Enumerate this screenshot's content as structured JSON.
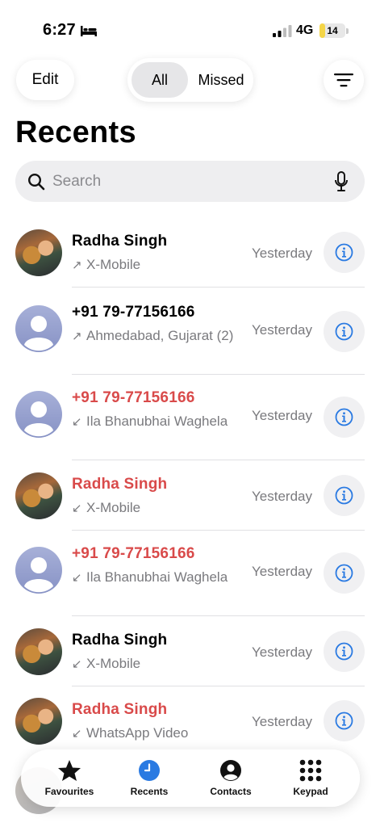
{
  "status_bar": {
    "time": "6:27",
    "network": "4G",
    "battery": "14",
    "battery_fraction": 0.14
  },
  "header": {
    "edit_label": "Edit",
    "filter_all": "All",
    "filter_missed": "Missed",
    "title": "Recents"
  },
  "search": {
    "placeholder": "Search"
  },
  "calls": [
    {
      "name": "Radha Singh",
      "detail": "X-Mobile",
      "direction": "outgoing",
      "when": "Yesterday",
      "missed": false,
      "avatar": "photo"
    },
    {
      "name": "+91 79-77156166",
      "detail": "Ahmedabad, Gujarat (2)",
      "direction": "outgoing",
      "when": "Yesterday",
      "missed": false,
      "avatar": "generic"
    },
    {
      "name": "+91 79-77156166",
      "detail": "Ila Bhanubhai Waghela",
      "direction": "incoming",
      "when": "Yesterday",
      "missed": true,
      "avatar": "generic"
    },
    {
      "name": "Radha Singh",
      "detail": "X-Mobile",
      "direction": "incoming",
      "when": "Yesterday",
      "missed": true,
      "avatar": "photo"
    },
    {
      "name": "+91 79-77156166",
      "detail": "Ila Bhanubhai Waghela",
      "direction": "incoming",
      "when": "Yesterday",
      "missed": true,
      "avatar": "generic"
    },
    {
      "name": "Radha Singh",
      "detail": "X-Mobile",
      "direction": "incoming",
      "when": "Yesterday",
      "missed": false,
      "avatar": "photo"
    },
    {
      "name": "Radha Singh",
      "detail": "WhatsApp Video",
      "direction": "incoming",
      "when": "Yesterday",
      "missed": true,
      "avatar": "photo"
    }
  ],
  "tabs": [
    {
      "label": "Favourites",
      "icon": "star-icon",
      "active": false
    },
    {
      "label": "Recents",
      "icon": "clock-icon",
      "active": true
    },
    {
      "label": "Contacts",
      "icon": "person-circle-icon",
      "active": false
    },
    {
      "label": "Keypad",
      "icon": "keypad-icon",
      "active": false
    }
  ],
  "colors": {
    "accent": "#2a7ae2",
    "missed": "#d94a4a",
    "secondary_text": "#7a7a7e",
    "battery": "#f4d548"
  }
}
